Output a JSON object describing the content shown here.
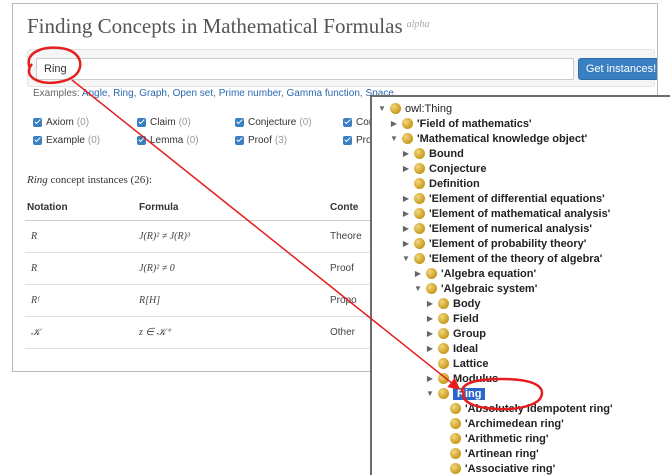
{
  "header": {
    "title": "Finding Concepts in Mathematical Formulas",
    "badge": "alpha"
  },
  "search": {
    "value": "Ring",
    "button_label": "Get instances!"
  },
  "examples": {
    "prefix": "Examples: ",
    "links": [
      "Angle",
      "Ring",
      "Graph",
      "Open set",
      "Prime number",
      "Gamma function",
      "Space"
    ]
  },
  "filters": [
    {
      "label": "Axiom",
      "count": "(0)"
    },
    {
      "label": "Claim",
      "count": "(0)"
    },
    {
      "label": "Conjecture",
      "count": "(0)"
    },
    {
      "label": "Con",
      "count": ""
    },
    {
      "label": "Example",
      "count": "(0)"
    },
    {
      "label": "Lemma",
      "count": "(0)"
    },
    {
      "label": "Proof",
      "count": "(3)"
    },
    {
      "label": "Prop",
      "count": ""
    }
  ],
  "results": {
    "concept": "Ring",
    "heading_rest": " concept instances (26):",
    "columns": [
      "Notation",
      "Formula",
      "Conte"
    ],
    "rows": [
      {
        "notation": "R",
        "formula": "J(R)² ≠ J(R)³",
        "context": "Theore"
      },
      {
        "notation": "R",
        "formula": "J(R)² ≠ 0",
        "context": "Proof"
      },
      {
        "notation": "Rᶠ",
        "formula": "R[H]",
        "context": "Propo"
      },
      {
        "notation": "𝒦",
        "formula": "z ∈ 𝒦⁺",
        "context": "Other"
      }
    ]
  },
  "tree": [
    {
      "label": "owl:Thing",
      "arrow": "down"
    },
    {
      "label": "'Field of mathematics'",
      "arrow": "right"
    },
    {
      "label": "'Mathematical knowledge object'",
      "arrow": "down"
    },
    {
      "label": "Bound",
      "arrow": "right"
    },
    {
      "label": "Conjecture",
      "arrow": "right"
    },
    {
      "label": "Definition",
      "arrow": "none"
    },
    {
      "label": "'Element of differential equations'",
      "arrow": "right"
    },
    {
      "label": "'Element of mathematical analysis'",
      "arrow": "right"
    },
    {
      "label": "'Element of numerical analysis'",
      "arrow": "right"
    },
    {
      "label": "'Element of probability theory'",
      "arrow": "right"
    },
    {
      "label": "'Element of the theory of algebra'",
      "arrow": "down"
    },
    {
      "label": "'Algebra equation'",
      "arrow": "right"
    },
    {
      "label": "'Algebraic system'",
      "arrow": "down"
    },
    {
      "label": "Body",
      "arrow": "right"
    },
    {
      "label": "Field",
      "arrow": "right"
    },
    {
      "label": "Group",
      "arrow": "right"
    },
    {
      "label": "Ideal",
      "arrow": "right"
    },
    {
      "label": "Lattice",
      "arrow": "none"
    },
    {
      "label": "Modulus",
      "arrow": "right"
    },
    {
      "label": "Ring",
      "arrow": "down",
      "selected": true
    },
    {
      "label": "'Absolutely idempotent ring'",
      "arrow": "none"
    },
    {
      "label": "'Archimedean ring'",
      "arrow": "none"
    },
    {
      "label": "'Arithmetic ring'",
      "arrow": "none"
    },
    {
      "label": "'Artinean ring'",
      "arrow": "none"
    },
    {
      "label": "'Associative ring'",
      "arrow": "none"
    }
  ],
  "colors": {
    "accent": "#3a7fc1",
    "annotation": "#e41e1e",
    "selection": "#2b67c9"
  }
}
